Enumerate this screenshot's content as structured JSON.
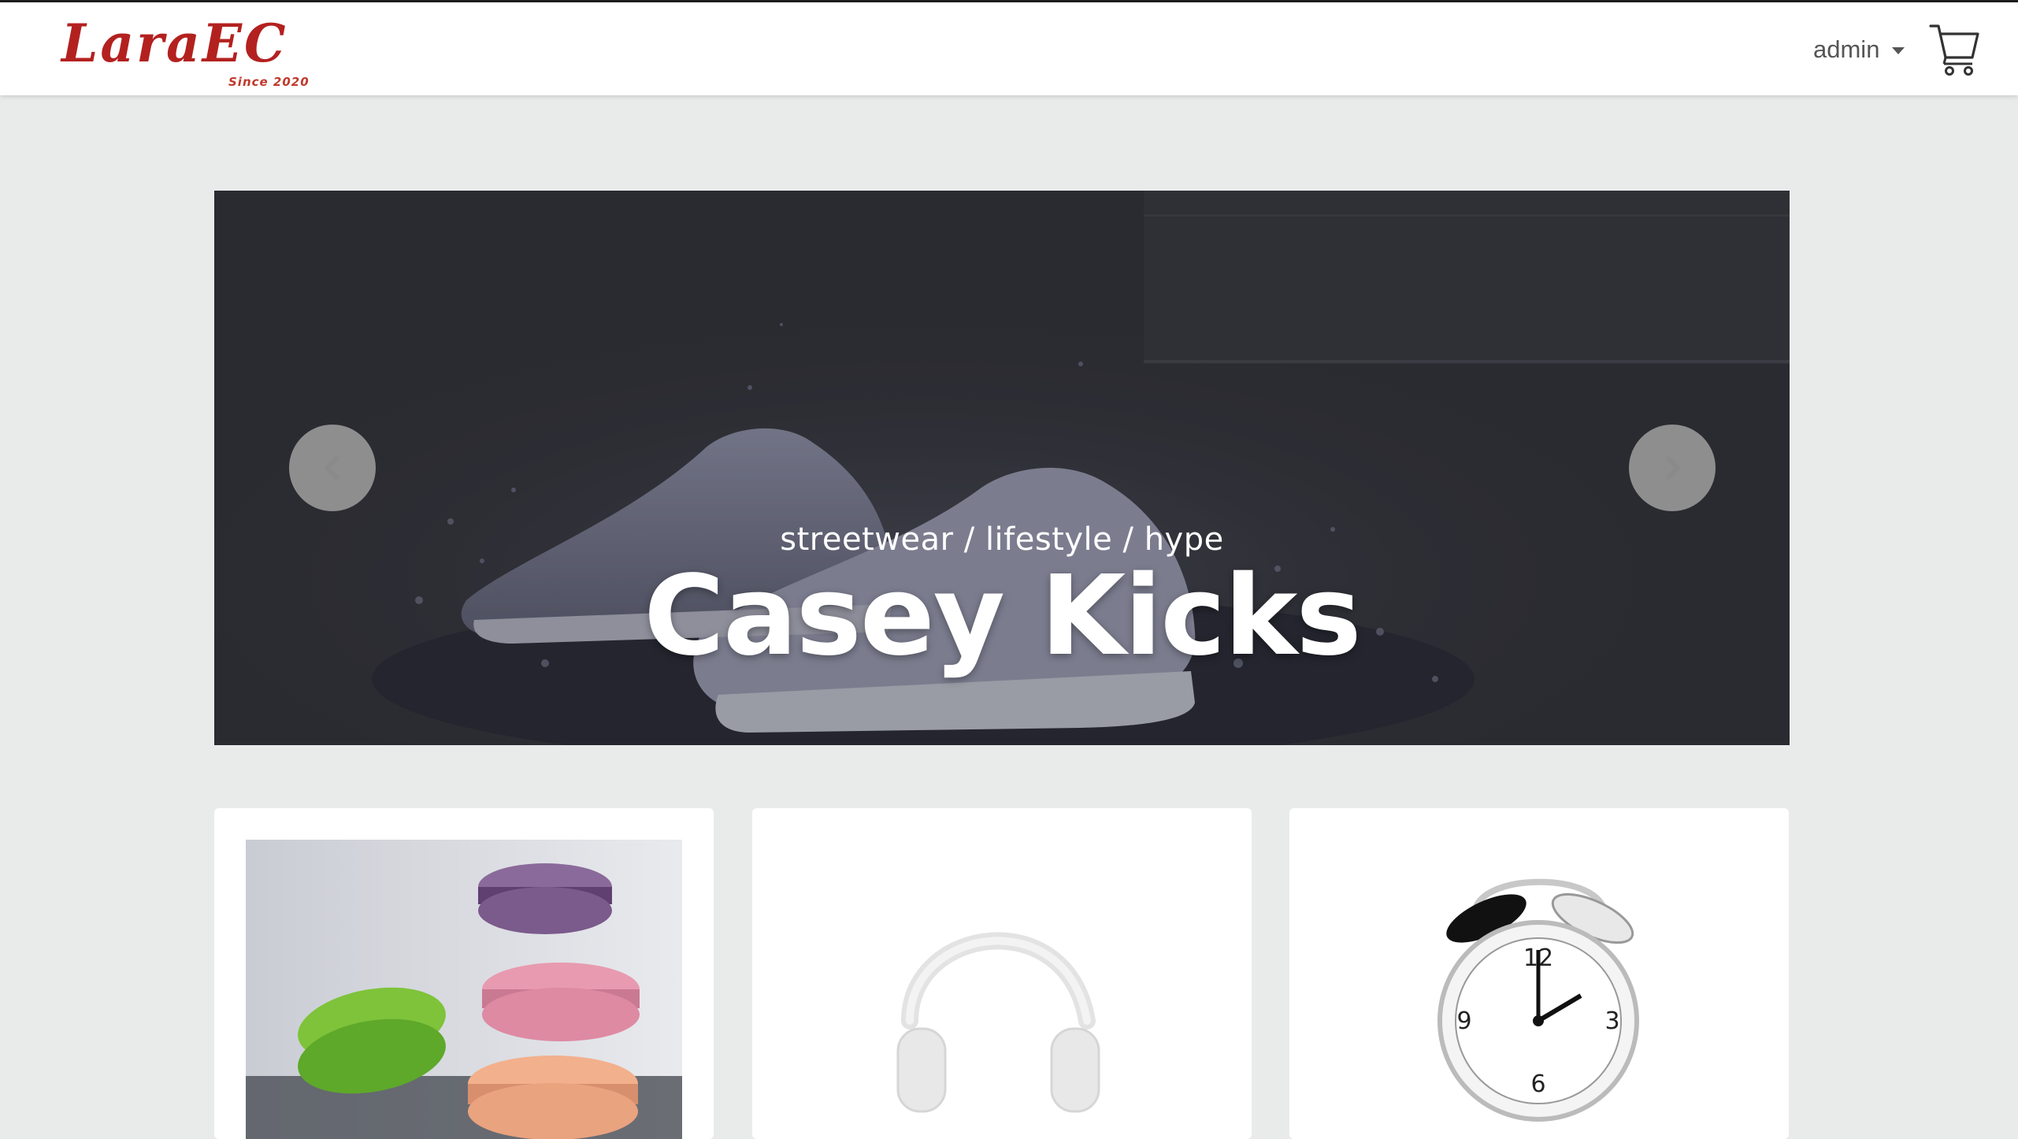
{
  "header": {
    "brand_name": "LaraEC",
    "brand_tagline": "Since 2020",
    "user_menu_label": "admin",
    "icons": {
      "cart": "shopping-cart-icon",
      "caret": "caret-down-icon"
    }
  },
  "hero": {
    "title": "Casey Kicks",
    "subtitle": "streetwear / lifestyle / hype",
    "image": "sneakers-splash",
    "controls": {
      "prev_icon": "chevron-left-icon",
      "next_icon": "chevron-right-icon"
    }
  },
  "products": [
    {
      "image": "macarons"
    },
    {
      "image": "headphones"
    },
    {
      "image": "alarm-clock"
    }
  ],
  "colors": {
    "brand": "#b3211f",
    "background": "#e9ebeb",
    "hero_overlay": "#2f3036"
  }
}
